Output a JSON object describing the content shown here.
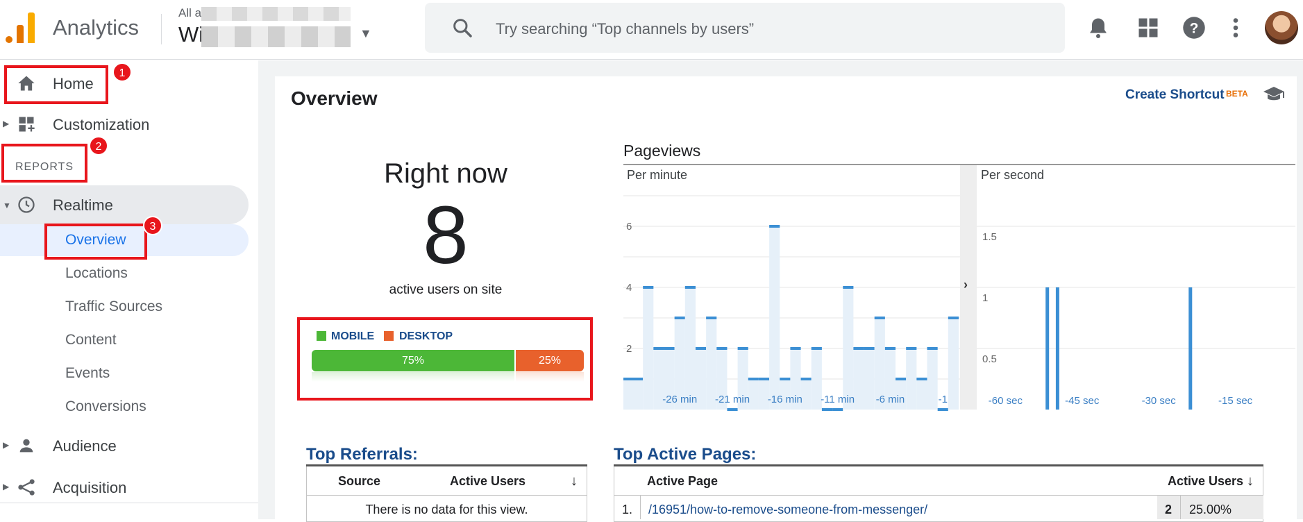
{
  "header": {
    "app_title": "Analytics",
    "account_line": "All ac                        es and Sol…",
    "property_name": "Wi                        T",
    "search_placeholder": "Try searching “Top channels by users”",
    "icons": [
      "search-icon",
      "notifications-icon",
      "apps-grid-icon",
      "help-icon",
      "more-vert-icon",
      "avatar"
    ]
  },
  "sidebar": {
    "home": "Home",
    "customization": "Customization",
    "reports_label": "REPORTS",
    "realtime": "Realtime",
    "realtime_items": [
      "Overview",
      "Locations",
      "Traffic Sources",
      "Content",
      "Events",
      "Conversions"
    ],
    "audience": "Audience",
    "acquisition": "Acquisition",
    "annotation_badges": [
      "1",
      "2",
      "3"
    ]
  },
  "overview": {
    "title": "Overview",
    "create_shortcut": "Create Shortcut",
    "beta": "BETA",
    "right_now_title": "Right now",
    "active_users": "8",
    "active_users_label": "active users on site",
    "device_legend": [
      "MOBILE",
      "DESKTOP"
    ],
    "device_split": {
      "mobile_label": "75%",
      "desktop_label": "25%",
      "mobile": 0.75,
      "desktop": 0.25
    },
    "colors": {
      "mobile": "#4cb737",
      "desktop": "#e8612c",
      "bar": "#3b8fd4",
      "bar_fill": "#e6f0f9",
      "accent": "#1a4c8b",
      "annotation": "#e8161c"
    }
  },
  "chart_data": [
    {
      "type": "bar",
      "title": "Pageviews",
      "subtitle": "Per minute",
      "x_tick_labels": [
        "-26 min",
        "-21 min",
        "-16 min",
        "-11 min",
        "-6 min",
        "-1"
      ],
      "y_tick_labels": [
        "2",
        "4",
        "6"
      ],
      "ylim": [
        0,
        8
      ],
      "values": [
        1,
        4,
        2,
        2,
        3,
        4,
        2,
        3,
        2,
        0,
        2,
        1,
        1,
        6,
        1,
        2,
        1,
        2,
        0,
        0,
        4,
        2,
        2,
        3,
        2,
        1,
        2,
        1,
        2,
        0,
        3
      ]
    },
    {
      "type": "bar",
      "subtitle": "Per second",
      "x_tick_labels": [
        "-60 sec",
        "-45 sec",
        "-30 sec",
        "-15 sec"
      ],
      "y_tick_labels": [
        "0.5",
        "1",
        "1.5"
      ],
      "ylim": [
        0,
        2
      ],
      "spikes": [
        {
          "x": -48,
          "value": 1
        },
        {
          "x": -46,
          "value": 1
        },
        {
          "x": -20,
          "value": 1
        }
      ]
    }
  ],
  "referrals": {
    "title": "Top Referrals:",
    "columns": [
      "Source",
      "Active Users"
    ],
    "empty_text": "There is no data for this view."
  },
  "active_pages": {
    "title": "Top Active Pages:",
    "columns": [
      "Active Page",
      "Active Users"
    ],
    "rows": [
      {
        "index": "1.",
        "page": "/16951/how-to-remove-someone-from-messenger/",
        "users": "2",
        "percent": "25.00%"
      }
    ]
  }
}
